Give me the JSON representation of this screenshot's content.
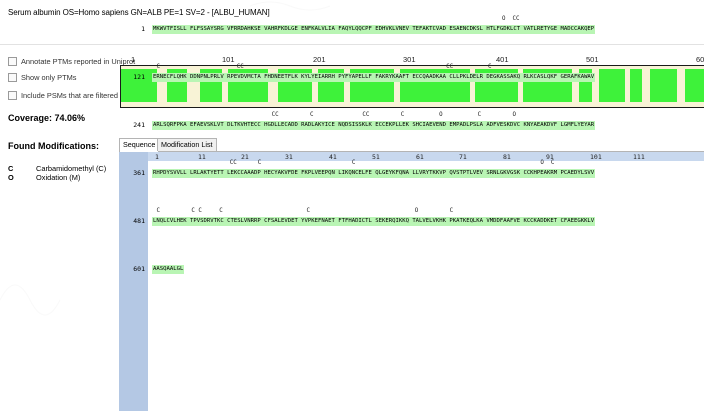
{
  "header": {
    "title": "Serum albumin OS=Homo sapiens GN=ALB PE=1 SV=2 - [ALBU_HUMAN]"
  },
  "options": [
    {
      "label": "Annotate PTMs reported in Uniprot",
      "checked": false
    },
    {
      "label": "Show only PTMs",
      "checked": false
    },
    {
      "label": "Include PSMs that are filtered Out",
      "checked": false
    }
  ],
  "coverage": {
    "label": "Coverage:",
    "value": "74.06%"
  },
  "found_mods": {
    "title": "Found Modifications:",
    "items": [
      {
        "code": "C",
        "name": "Carbamidomethyl (C)"
      },
      {
        "code": "O",
        "name": "Oxidation (M)"
      }
    ]
  },
  "ruler": {
    "ticks": [
      "1",
      "101",
      "201",
      "301",
      "401",
      "501",
      "60"
    ]
  },
  "tabs": [
    {
      "label": "Sequence",
      "active": true
    },
    {
      "label": "Modification List",
      "active": false
    }
  ],
  "sequence": {
    "column_numbers": [
      "1",
      "11",
      "21",
      "31",
      "41",
      "51",
      "61",
      "71",
      "81",
      "91",
      "101",
      "111"
    ],
    "rows": [
      {
        "num": "1",
        "mods": "                                                                                                    O  CC",
        "seq": "MKWVTFISLL FLFSSAYSRG VFRRDAHKSE VAHRFKDLGE ENFKALVLIA FAQYLQQCPF EDHVKLVNEV TEFAKTCVAD ESAENCDKSL HTLFGDKLCT VATLRETYGE MADCCAKQEP"
      },
      {
        "num": "121",
        "mods": " C                      CC                                                          CC          C",
        "seq": "ERNECFLQHK DDNPNLPRLV RPEVDVMCTA FHDNEETFLK KYLYEIARRH PYFYAPELLF FAKRYKAAFT ECCQAADKAA CLLPKLDELR DEGKASSAKQ RLKCASLQKF GERAFKAWAV"
      },
      {
        "num": "241",
        "mods": "                                  CC         C              CC         C          O          C         O",
        "seq": "ARLSQRFPKA EFAEVSKLVT DLTKVHTECC HGDLLECADD RADLAKYICE NQDSISSKLK ECCEKPLLEK SHCIAEVEND EMPADLPSLA ADFVESKDVC KNYAEAKDVF LGMFLYEYAR"
      },
      {
        "num": "361",
        "mods": "                      CC      C                          C                                                     O  C",
        "seq": "RHPDYSVVLL LRLAKTYETT LEKCCAAADP HECYAKVFDE FKPLVEEPQN LIKQNCELFE QLGEYKFQNA LLVRYTKKVP QVSTPTLVEV SRNLGKVGSK CCKHPEAKRM PCAEDYLSVV"
      },
      {
        "num": "481",
        "mods": " C         C C     C                        C                              O         C",
        "seq": "LNQLCVLHEK TPVSDRVTKC CTESLVNRRP CFSALEVDET YVPKEFNAET FTFHADICTL SEKERQIKKQ TALVELVKHK PKATKEQLKA VMDDFAAFVE KCCKADDKET CFAEEGKKLV"
      },
      {
        "num": "601",
        "mods": "",
        "seq": "AASQAALGL"
      }
    ]
  },
  "colors": {
    "covered": "#3ef23a",
    "uncovered": "#f8f3d6",
    "highlight": "#b9f5b4",
    "gutter": "#b4c8e4"
  },
  "coverage_map": [
    [
      0.0,
      0.062
    ],
    [
      0.078,
      0.112
    ],
    [
      0.136,
      0.173
    ],
    [
      0.183,
      0.252
    ],
    [
      0.268,
      0.327
    ],
    [
      0.338,
      0.383
    ],
    [
      0.392,
      0.467
    ],
    [
      0.478,
      0.598
    ],
    [
      0.606,
      0.679
    ],
    [
      0.689,
      0.773
    ],
    [
      0.784,
      0.807
    ],
    [
      0.818,
      0.862
    ],
    [
      0.872,
      0.893
    ],
    [
      0.905,
      0.952
    ],
    [
      0.965,
      1.0
    ]
  ]
}
